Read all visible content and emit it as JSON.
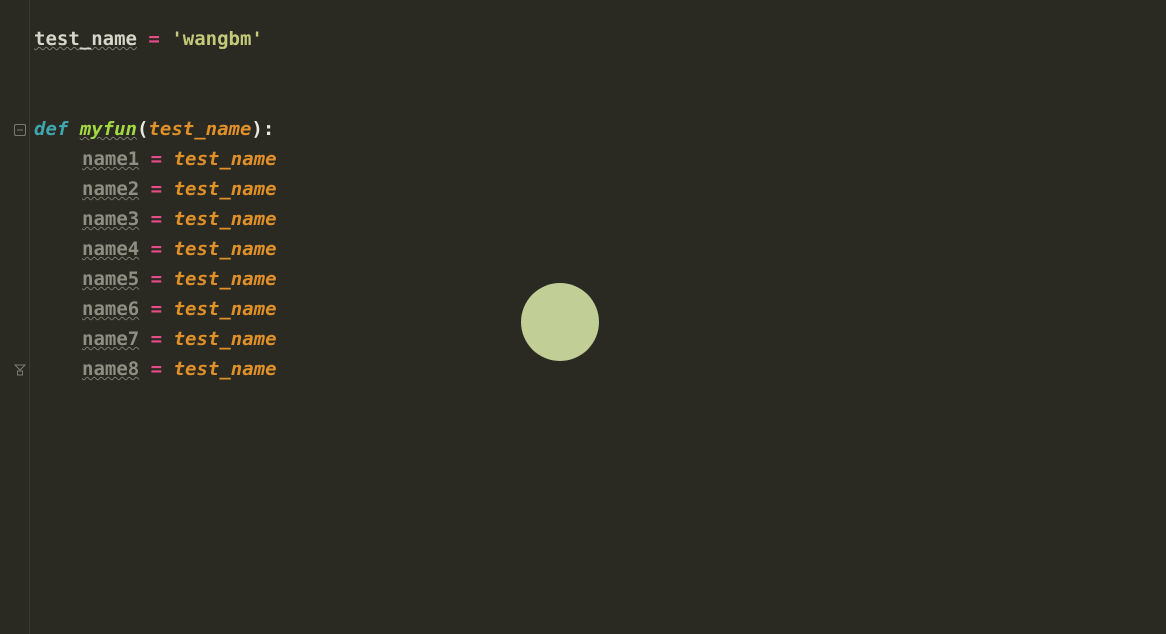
{
  "global": {
    "var_name": "test_name",
    "assign_op": "=",
    "string_value": "'wangbm'"
  },
  "func": {
    "def_keyword": "def",
    "name": "myfun",
    "open_paren": "(",
    "param": "test_name",
    "close_paren": ")",
    "colon": ":"
  },
  "body": [
    {
      "lhs": "name1",
      "op": "=",
      "rhs": "test_name"
    },
    {
      "lhs": "name2",
      "op": "=",
      "rhs": "test_name"
    },
    {
      "lhs": "name3",
      "op": "=",
      "rhs": "test_name"
    },
    {
      "lhs": "name4",
      "op": "=",
      "rhs": "test_name"
    },
    {
      "lhs": "name5",
      "op": "=",
      "rhs": "test_name"
    },
    {
      "lhs": "name6",
      "op": "=",
      "rhs": "test_name"
    },
    {
      "lhs": "name7",
      "op": "=",
      "rhs": "test_name"
    },
    {
      "lhs": "name8",
      "op": "=",
      "rhs": "test_name"
    }
  ],
  "icons": {
    "fold_minus": "fold-minus-icon",
    "fold_end": "fold-end-icon"
  }
}
